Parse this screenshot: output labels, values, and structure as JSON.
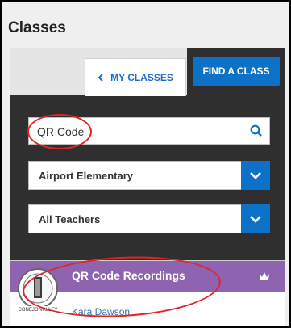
{
  "page": {
    "title": "Classes"
  },
  "tabs": {
    "my_classes_label": "MY CLASSES",
    "find_class_label": "FIND A CLASS"
  },
  "search": {
    "value": "QR Code",
    "placeholder": "QR Code"
  },
  "filters": {
    "school": "Airport Elementary",
    "teacher": "All Teachers"
  },
  "result": {
    "title": "QR Code Recordings",
    "teacher": "Kara Dawson",
    "logo_text": "CONEJO VALLEY"
  },
  "colors": {
    "accent": "#0d72c7",
    "result_header": "#8e64b0",
    "annotation": "#e0242a",
    "panel": "#2f2f2f"
  },
  "icons": {
    "back": "chevron-left-icon",
    "search": "search-icon",
    "dropdown": "chevron-down-icon",
    "premium": "crown-icon"
  }
}
